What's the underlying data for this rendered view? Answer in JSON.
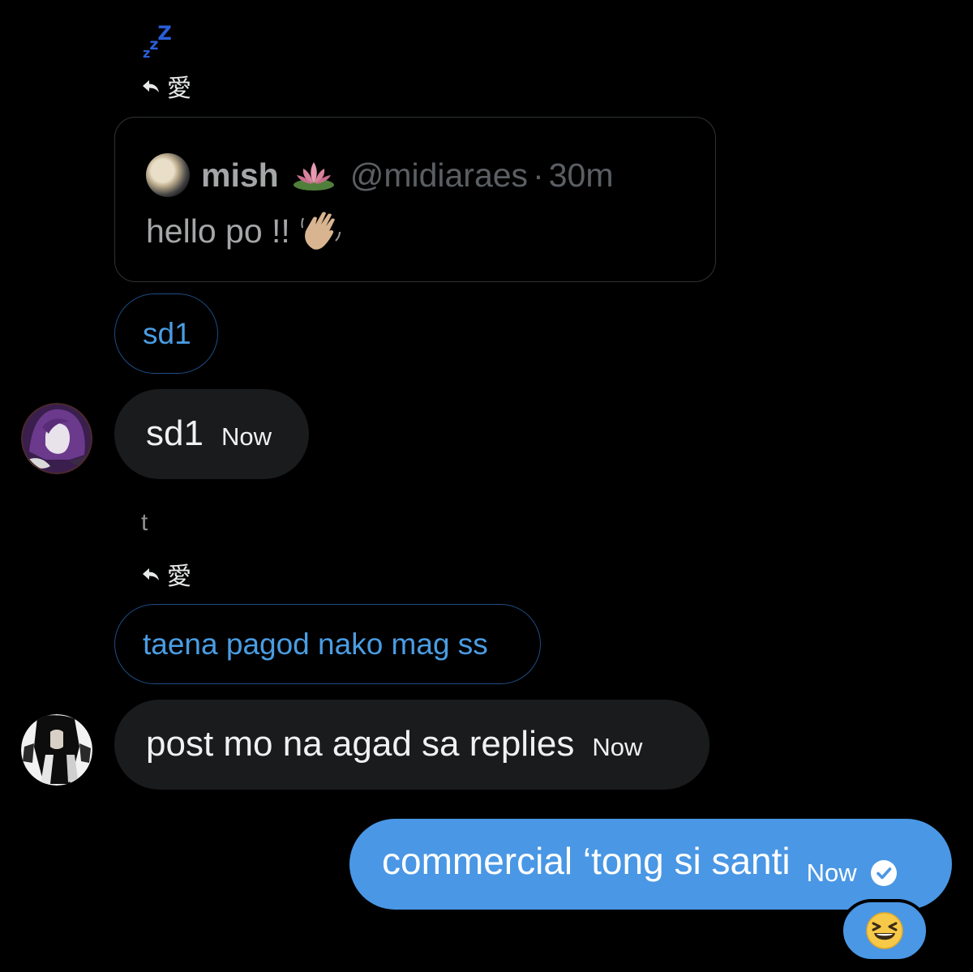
{
  "thread": {
    "group1": {
      "sender_marker": "ᶻzᶻ",
      "reply_target": "愛",
      "quoted_post": {
        "author_name": "mish",
        "author_emoji_icon": "lotus-emoji",
        "handle": "@midiaraes",
        "separator": "·",
        "time": "30m",
        "text": "hello po !!",
        "text_emoji_icon": "waving-hand-emoji"
      },
      "reply_text": "sd1",
      "message": {
        "text": "sd1",
        "time": "Now"
      }
    },
    "group2": {
      "sender_marker": "t",
      "reply_target": "愛",
      "reply_text": "taena pagod nako mag ss",
      "message": {
        "text": "post mo na agad sa replies",
        "time": "Now"
      }
    },
    "outgoing": {
      "text": "commercial ‘tong si santi",
      "time": "Now",
      "status_icon": "read-check-icon",
      "reaction_icon": "grinning-squinting-face-emoji"
    }
  },
  "colors": {
    "background": "#000000",
    "incoming_bubble": "#1a1b1d",
    "outgoing_bubble": "#4a97e5",
    "reply_pill_text": "#4a9de3",
    "sender_marker_blue": "#2b5fd9"
  }
}
